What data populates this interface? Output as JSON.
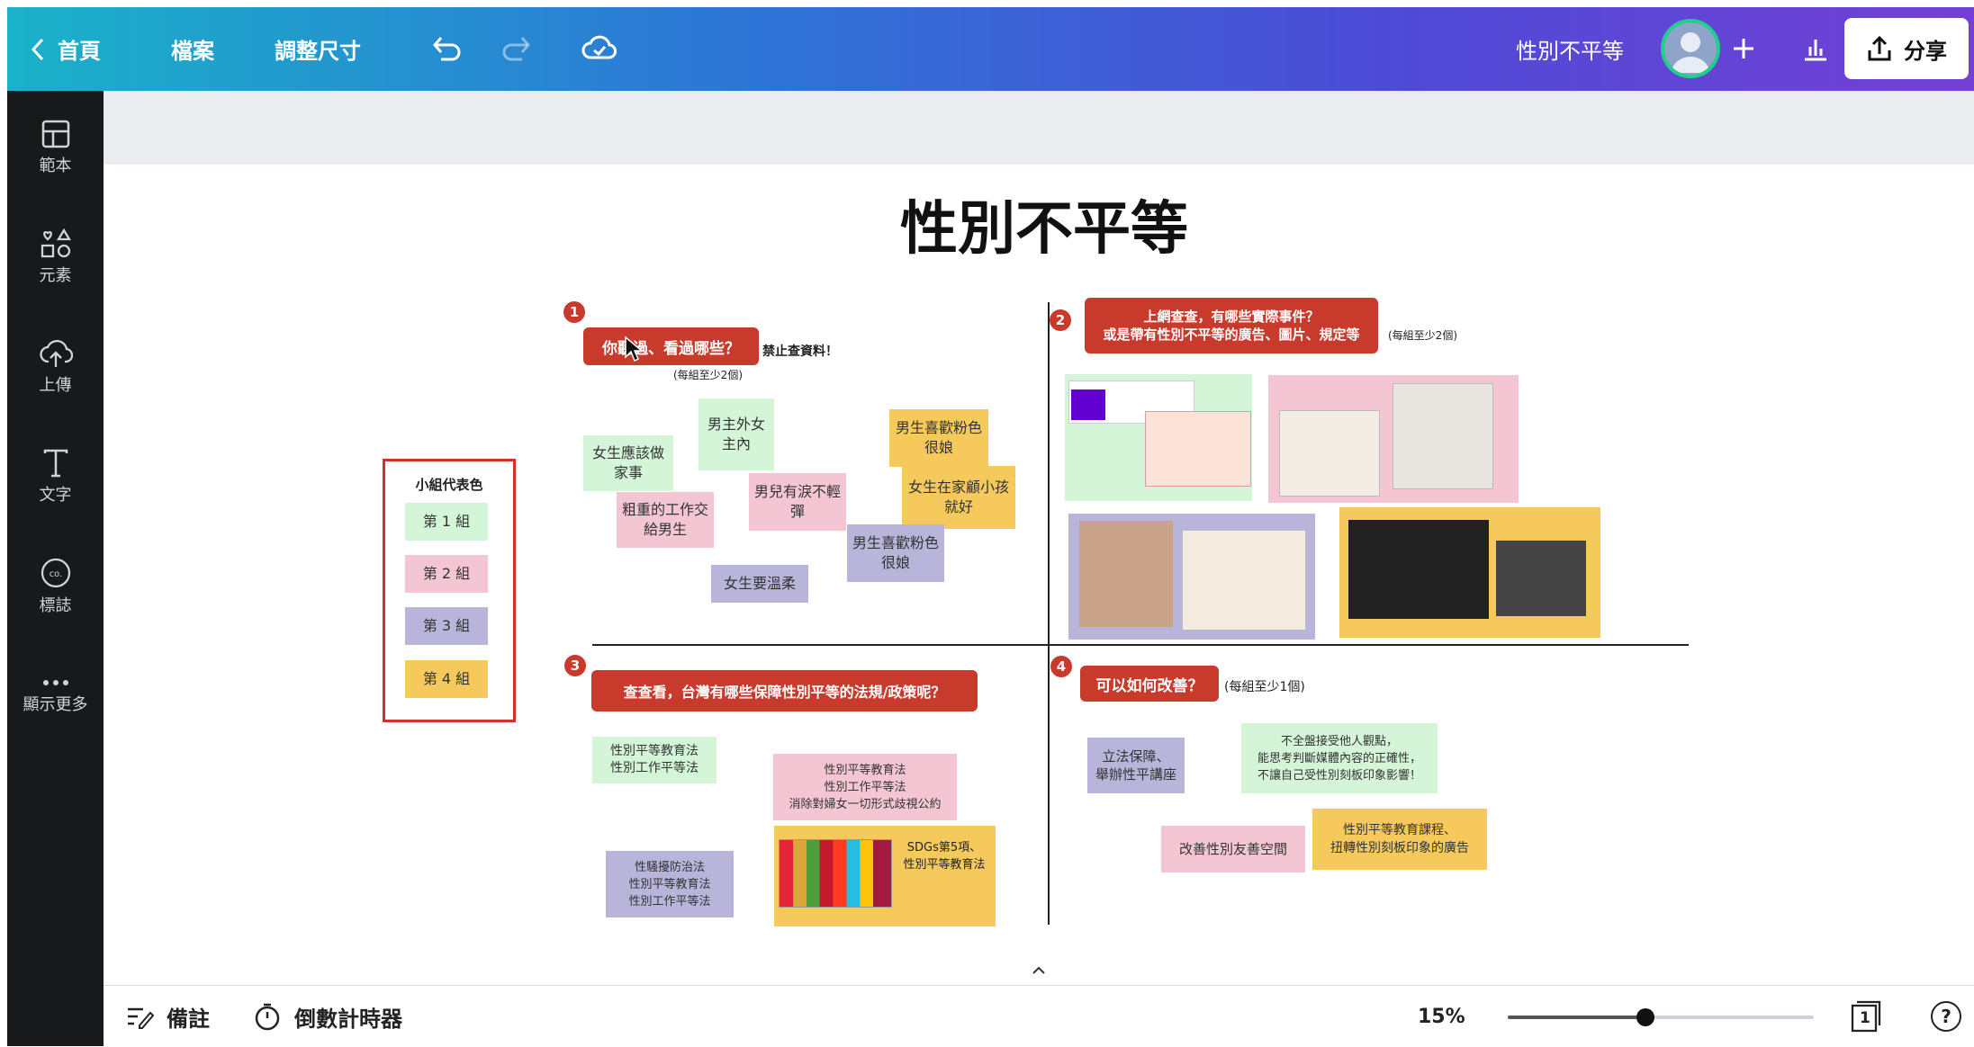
{
  "topbar": {
    "home": "首頁",
    "file": "檔案",
    "resize": "調整尺寸",
    "doc_title": "性別不平等",
    "share": "分享"
  },
  "sidebar": {
    "items": [
      {
        "label": "範本",
        "icon": "template-icon"
      },
      {
        "label": "元素",
        "icon": "elements-icon"
      },
      {
        "label": "上傳",
        "icon": "upload-icon"
      },
      {
        "label": "文字",
        "icon": "text-icon"
      },
      {
        "label": "標誌",
        "icon": "logo-icon"
      },
      {
        "label": "顯示更多",
        "icon": "more-icon"
      }
    ]
  },
  "page": {
    "title": "性別不平等",
    "legend": {
      "title": "小組代表色",
      "groups": [
        "第 1 組",
        "第 2 組",
        "第 3 組",
        "第 4 組"
      ]
    },
    "q1": {
      "num": "1",
      "tag": "你聽過、看過哪些？",
      "warn": "禁止查資料！",
      "hint": "(每組至少2個)",
      "notes": [
        "男主外女主內",
        "女生應該做家事",
        "男生喜歡粉色很娘",
        "男兒有淚不輕彈",
        "女生在家顧小孩就好",
        "粗重的工作交給男生",
        "男生喜歡粉色很娘",
        "女生要溫柔"
      ]
    },
    "q2": {
      "num": "2",
      "tag_line1": "上網查查，有哪些實際事件？",
      "tag_line2": "或是帶有性別不平等的廣告、圖片、規定等",
      "hint": "(每組至少2個)"
    },
    "q3": {
      "num": "3",
      "tag": "查查看，台灣有哪些保障性別平等的法規/政策呢？",
      "notes": [
        "性別平等教育法\n性別工作平等法",
        "性別平等教育法\n性別工作平等法\n消除對婦女一切形式歧視公約",
        "性騷擾防治法\n性別平等教育法\n性別工作平等法",
        "SDGs第5項、\n性別平等教育法"
      ]
    },
    "q4": {
      "num": "4",
      "tag": "可以如何改善？",
      "hint": "(每組至少1個)",
      "notes": [
        "立法保障、\n舉辦性平講座",
        "不全盤接受他人觀點，\n能思考判斷媒體內容的正確性，\n不讓自己受性別刻板印象影響！",
        "改善性別友善空間",
        "性別平等教育課程、\n扭轉性別刻板印象的廣告"
      ]
    }
  },
  "bottombar": {
    "notes": "備註",
    "timer": "倒數計時器",
    "zoom": "15%",
    "zoom_level": 0.45,
    "page_num": "1",
    "help": "?"
  }
}
